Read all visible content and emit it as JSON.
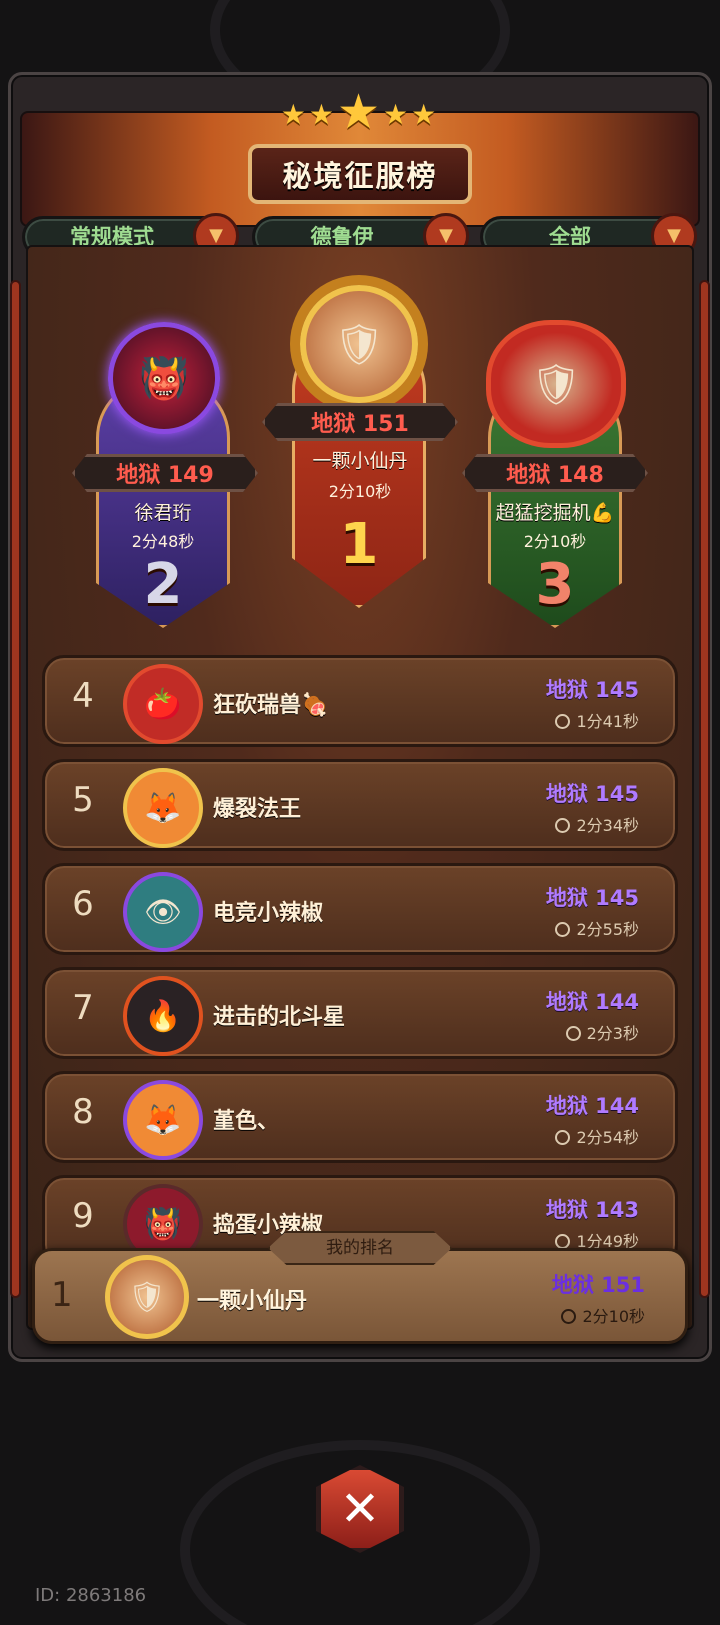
{
  "title": "秘境征服榜",
  "filters": [
    {
      "label": "常规模式"
    },
    {
      "label": "德鲁伊"
    },
    {
      "label": "全部"
    }
  ],
  "podium": {
    "first": {
      "score": "地狱 151",
      "name": "一颗小仙丹",
      "time": "2分10秒",
      "rank": "1"
    },
    "second": {
      "score": "地狱 149",
      "name": "徐君珩",
      "time": "2分48秒",
      "rank": "2"
    },
    "third": {
      "score": "地狱 148",
      "name": "超猛挖掘机💪",
      "time": "2分10秒",
      "rank": "3"
    }
  },
  "rows": [
    {
      "rank": "4",
      "name": "狂砍瑞兽🍖",
      "score": "地狱 145",
      "time": "1分41秒"
    },
    {
      "rank": "5",
      "name": "爆裂法王",
      "score": "地狱 145",
      "time": "2分34秒"
    },
    {
      "rank": "6",
      "name": "电竞小辣椒",
      "score": "地狱 145",
      "time": "2分55秒"
    },
    {
      "rank": "7",
      "name": "进击的北斗星",
      "score": "地狱 144",
      "time": "2分3秒"
    },
    {
      "rank": "8",
      "name": "堇色、",
      "score": "地狱 144",
      "time": "2分54秒"
    },
    {
      "rank": "9",
      "name": "捣蛋小辣椒",
      "score": "地狱 143",
      "time": "1分49秒"
    }
  ],
  "my_rank": {
    "label": "我的排名",
    "rank": "1",
    "name": "一颗小仙丹",
    "score": "地狱 151",
    "time": "2分10秒"
  },
  "footer": {
    "id": "ID: 2863186"
  },
  "colors": {
    "score_red": "#ff5c4e",
    "score_purple": "#b07bff",
    "filter_green": "#9fdc91"
  }
}
